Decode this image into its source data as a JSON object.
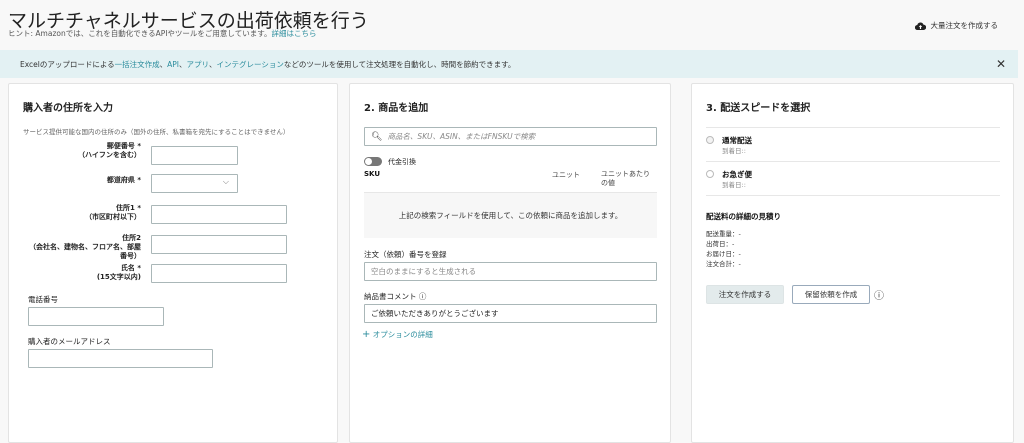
{
  "header": {
    "title": "マルチチャネルサービスの出荷依頼を行う",
    "hint": "ヒント: Amazonでは、これを自動化できるAPIやツールをご用意しています。",
    "hint_link": "詳細はこちら",
    "bulk_label": "大量注文を作成する"
  },
  "banner": {
    "prefix": "Excelのアップロードによる",
    "link1": "一括注文作成",
    "sep1": "、",
    "link2": "API",
    "sep2": "、",
    "link3": "アプリ",
    "sep3": "、",
    "link4": "インテグレーション",
    "suffix": "などのツールを使用して注文処理を自動化し、時間を節約できます。",
    "close": "✕"
  },
  "address": {
    "title": "購入者の住所を入力",
    "note": "サービス提供可能な国内の住所のみ（国外の住所、私書箱を宛先にすることはできません）",
    "postal": [
      "郵便番号 *",
      "（ハイフンを含む）"
    ],
    "prefecture": "都道府県 *",
    "addr1": [
      "住所1 *",
      "（市区町村以下）"
    ],
    "addr2": [
      "住所2",
      "（会社名、建物名、フロア名、部屋",
      "番号）"
    ],
    "name": [
      "氏名 *",
      "(15文字以内)"
    ],
    "phone": "電話番号",
    "email": "購入者のメールアドレス"
  },
  "products": {
    "title": "2. 商品を追加",
    "search_placeholder": "商品名、SKU、ASIN、またはFNSKUで検索",
    "cod": "代金引換",
    "col_sku": "SKU",
    "col_unit": "ユニット",
    "col_price": "ユニットあたりの値",
    "empty": "上記の検索フィールドを使用して、この依頼に商品を追加します。",
    "order_no_label": "注文（依頼）番号を登録",
    "order_no_placeholder": "空白のままにすると生成される",
    "comment_label": "納品書コメント",
    "comment_value": "ご依頼いただきありがとうございます",
    "options": "オプションの詳細"
  },
  "shipping": {
    "title": "3. 配送スピードを選択",
    "options": [
      {
        "label": "通常配送",
        "sub": "到着日::"
      },
      {
        "label": "お急ぎ便",
        "sub": "到着日::"
      }
    ],
    "estimate_title": "配送料の詳細の見積り",
    "lines": [
      "配送重量：-",
      "出荷日：-",
      "お届け日：-",
      "注文合計：-"
    ],
    "create": "注文を作成する",
    "hold": "保留依頼を作成"
  }
}
